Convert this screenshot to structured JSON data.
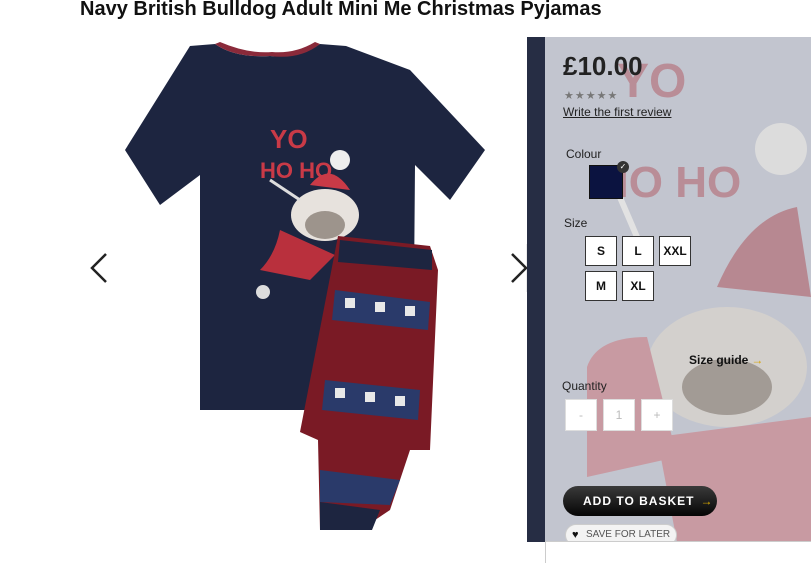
{
  "product": {
    "title": "Navy British Bulldog Adult Mini Me Christmas Pyjamas",
    "price": "£10.00",
    "stars": "★★★★★",
    "review_link": "Write the first review",
    "tee_print": {
      "line1": "YO",
      "line2": "HO HO"
    },
    "background_print": {
      "line1": "YO",
      "line2": "HO HO"
    }
  },
  "options": {
    "colour_label": "Colour",
    "selected_colour": "#0b1340",
    "size_label": "Size",
    "sizes": [
      "S",
      "L",
      "XXL",
      "M",
      "XL"
    ],
    "size_guide": "Size guide",
    "size_guide_chevron": "→",
    "quantity_label": "Quantity",
    "qty_minus": "-",
    "qty_value": "1",
    "qty_plus": "+"
  },
  "actions": {
    "add_to_basket": "ADD TO BASKET",
    "basket_chevron": "→",
    "save_for_later": "SAVE FOR LATER"
  },
  "colors": {
    "navy": "#1d2540",
    "panel_strip": "#262d44",
    "accent_gold": "#d8a200"
  }
}
